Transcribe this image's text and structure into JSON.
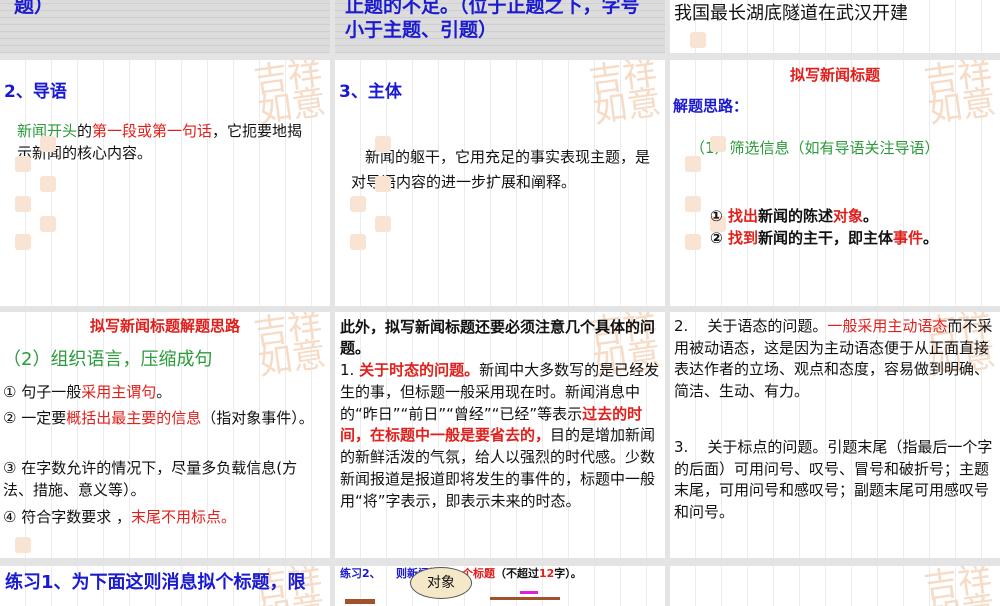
{
  "colors": {
    "blue": "#1a1ad0",
    "red": "#e0201c",
    "green": "#2a9a3a",
    "background": "#e4e4e4"
  },
  "watermark": "吉祥意",
  "slides": {
    "r1c1": {
      "p1": [
        {
          "t": "题）",
          "c": "blue"
        }
      ]
    },
    "r1c2": {
      "p1": [
        {
          "t": "止题的不足。（位于正题之下，字号",
          "c": "blue"
        }
      ],
      "p2": [
        {
          "t": "小于主题、引题）",
          "c": "blue"
        }
      ]
    },
    "r1c3": {
      "p1": [
        {
          "t": "我国最长湖底隧道在武汉开建",
          "c": "black"
        }
      ]
    },
    "r2c1": {
      "h": [
        {
          "t": "2、导语",
          "c": "blue"
        }
      ],
      "p1": [
        {
          "t": "新闻开头",
          "c": "green"
        },
        {
          "t": "的",
          "c": "black"
        },
        {
          "t": "第一段或第一句话",
          "c": "red"
        },
        {
          "t": "，它扼要地揭示新闻的核心内容。",
          "c": "black"
        }
      ]
    },
    "r2c2": {
      "h": [
        {
          "t": "3、主体",
          "c": "blue"
        }
      ],
      "p1": [
        {
          "t": "新闻的躯干，它用充足的事实表现主题，是对导语内容的进一步扩展和阐释。",
          "c": "black"
        }
      ]
    },
    "r2c3": {
      "title": [
        {
          "t": "拟写新闻标题",
          "c": "red"
        }
      ],
      "h": [
        {
          "t": "解题思路：",
          "c": "blue"
        }
      ],
      "p1": [
        {
          "t": "（1）筛选信息（如有导语关注导语）",
          "c": "green"
        }
      ],
      "p2": [
        {
          "t": "① ",
          "c": "black"
        },
        {
          "t": "找出",
          "c": "red"
        },
        {
          "t": "新闻的陈述",
          "c": "black"
        },
        {
          "t": "对象",
          "c": "red"
        },
        {
          "t": "。",
          "c": "black"
        }
      ],
      "p3": [
        {
          "t": "② ",
          "c": "black"
        },
        {
          "t": "找到",
          "c": "red"
        },
        {
          "t": "新闻的主干，即主体",
          "c": "black"
        },
        {
          "t": "事件",
          "c": "red"
        },
        {
          "t": "。",
          "c": "black"
        }
      ]
    },
    "r3c1": {
      "title": [
        {
          "t": "拟写新闻标题解题思路",
          "c": "red"
        }
      ],
      "h": [
        {
          "t": "（2）组织语言，压缩成句",
          "c": "green"
        }
      ],
      "p1": [
        {
          "t": "① 句子一般",
          "c": "black"
        },
        {
          "t": "采用主谓句",
          "c": "red"
        },
        {
          "t": "。",
          "c": "black"
        }
      ],
      "p2": [
        {
          "t": "② 一定要",
          "c": "black"
        },
        {
          "t": "概括出最主要的信息",
          "c": "red"
        },
        {
          "t": "（指对象事件）。",
          "c": "black"
        }
      ],
      "p3": [
        {
          "t": "③ 在字数允许的情况下，尽量多负载信息(方法、措施、意义等）。",
          "c": "black"
        }
      ],
      "p4": [
        {
          "t": "④ 符合字数要求 ，",
          "c": "black"
        },
        {
          "t": "末尾不用标点。",
          "c": "red"
        }
      ]
    },
    "r3c2": {
      "h": [
        {
          "t": "此外，拟写新闻标题还要必须注意几个具体的问题。",
          "c": "black"
        }
      ],
      "p1": [
        {
          "t": "1.  ",
          "c": "black"
        },
        {
          "t": "关于时态的问题。",
          "c": "red",
          "b": true
        },
        {
          "t": "新闻中大多数写的是已经发生的事，但标题一般采用现在时。新闻消息中的“昨日”“前日”“曾经”“已经”等表示",
          "c": "black"
        },
        {
          "t": "过去的时间，在标题中一般是要省去的，",
          "c": "red",
          "b": true
        },
        {
          "t": "目的是增加新闻的新鲜活泼的气氛，给人以强烈的时代感。少数新闻报道是报道即将发生的事件的，标题中一般用“将”字表示，即表示未来的时态。",
          "c": "black"
        }
      ]
    },
    "r3c3": {
      "p1": [
        {
          "t": "2.    关于语态的问题。",
          "c": "black"
        },
        {
          "t": "一般采用主动语态",
          "c": "red"
        },
        {
          "t": "而不采用被动语态，这是因为主动语态便于从正面直接表达作者的立场、观点和态度，容易做到明确、简洁、生动、有力。",
          "c": "black"
        }
      ],
      "p2": [
        {
          "t": "3.    关于标点的问题。引题末尾（指最后一个字的后面）可用问号、叹号、冒号和破折号；主题末尾，可用问号和感叹号；副题末尾可用感叹号和问号。",
          "c": "black"
        }
      ]
    },
    "r4c1": {
      "p1": [
        {
          "t": "练习1、为下面这则消息拟个标题，限",
          "c": "blue"
        }
      ]
    },
    "r4c2": {
      "p1": [
        {
          "t": "练习2、",
          "c": "blue"
        },
        {
          "t": "    则新闻",
          "c": "blue"
        },
        {
          "t": "拟写一个标题",
          "c": "red"
        },
        {
          "t": "（不超过",
          "c": "black"
        },
        {
          "t": "12",
          "c": "red"
        },
        {
          "t": "字）。",
          "c": "black"
        }
      ],
      "cloud": "对象"
    }
  }
}
